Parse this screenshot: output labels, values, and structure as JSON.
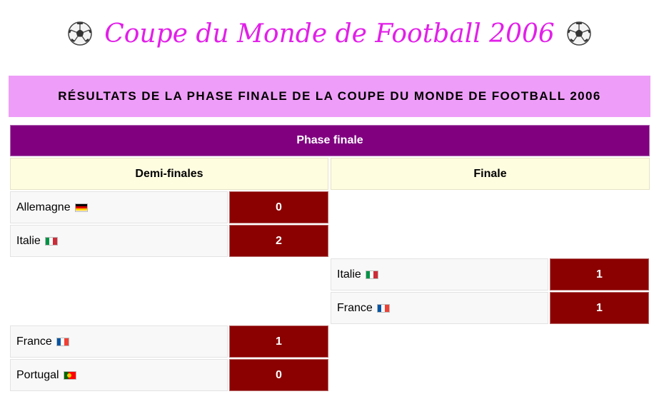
{
  "page": {
    "title": "Coupe du Monde de Football 2006",
    "icon": "soccer-ball-icon"
  },
  "banner": {
    "text": "RÉSULTATS DE LA PHASE FINALE DE LA COUPE DU MONDE DE FOOTBALL 2006"
  },
  "bracket": {
    "phase_label": "Phase finale",
    "rounds": [
      {
        "label": "Demi-finales",
        "matches": [
          {
            "teams": [
              {
                "name": "Allemagne",
                "flag": "germany-flag-icon",
                "score": "0"
              },
              {
                "name": "Italie",
                "flag": "italy-flag-icon",
                "score": "2"
              }
            ]
          },
          {
            "teams": [
              {
                "name": "France",
                "flag": "france-flag-icon",
                "score": "1"
              },
              {
                "name": "Portugal",
                "flag": "portugal-flag-icon",
                "score": "0"
              }
            ]
          }
        ]
      },
      {
        "label": "Finale",
        "matches": [
          {
            "teams": [
              {
                "name": "Italie",
                "flag": "italy-flag-icon",
                "score": "1"
              },
              {
                "name": "France",
                "flag": "france-flag-icon",
                "score": "1"
              }
            ]
          }
        ]
      }
    ]
  },
  "colors": {
    "title": "#e21fe9",
    "banner_bg": "#ee9ef8",
    "phase_bg": "#800080",
    "round_bg": "#fffde0",
    "score_bg": "#8b0000"
  }
}
